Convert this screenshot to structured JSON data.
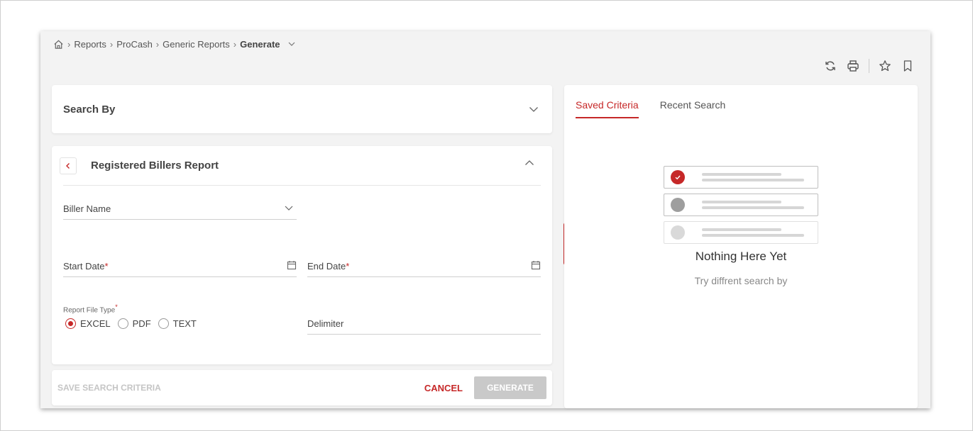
{
  "breadcrumb": {
    "items": [
      "Reports",
      "ProCash",
      "Generic Reports"
    ],
    "current": "Generate"
  },
  "icons": {
    "home": "home-icon",
    "refresh": "refresh-icon",
    "print": "print-icon",
    "favorite": "star-icon",
    "bookmark": "bookmark-icon"
  },
  "search_by": {
    "title": "Search By"
  },
  "report": {
    "title": "Registered Billers Report",
    "biller_name_label": "Biller Name",
    "start_date_label": "Start Date",
    "end_date_label": "End Date",
    "required_mark": "*",
    "file_type_label": "Report File Type",
    "file_types": [
      {
        "label": "EXCEL",
        "checked": true
      },
      {
        "label": "PDF",
        "checked": false
      },
      {
        "label": "TEXT",
        "checked": false
      }
    ],
    "delimiter_label": "Delimiter"
  },
  "footer": {
    "save_label": "SAVE SEARCH CRITERIA",
    "cancel_label": "CANCEL",
    "generate_label": "GENERATE"
  },
  "right_panel": {
    "tabs": [
      {
        "label": "Saved Criteria",
        "active": true
      },
      {
        "label": "Recent Search",
        "active": false
      }
    ],
    "empty_title": "Nothing Here Yet",
    "empty_subtitle": "Try diffrent search by"
  },
  "colors": {
    "accent": "#c62828",
    "disabled": "#c9c9c9",
    "background": "#f3f3f3"
  }
}
